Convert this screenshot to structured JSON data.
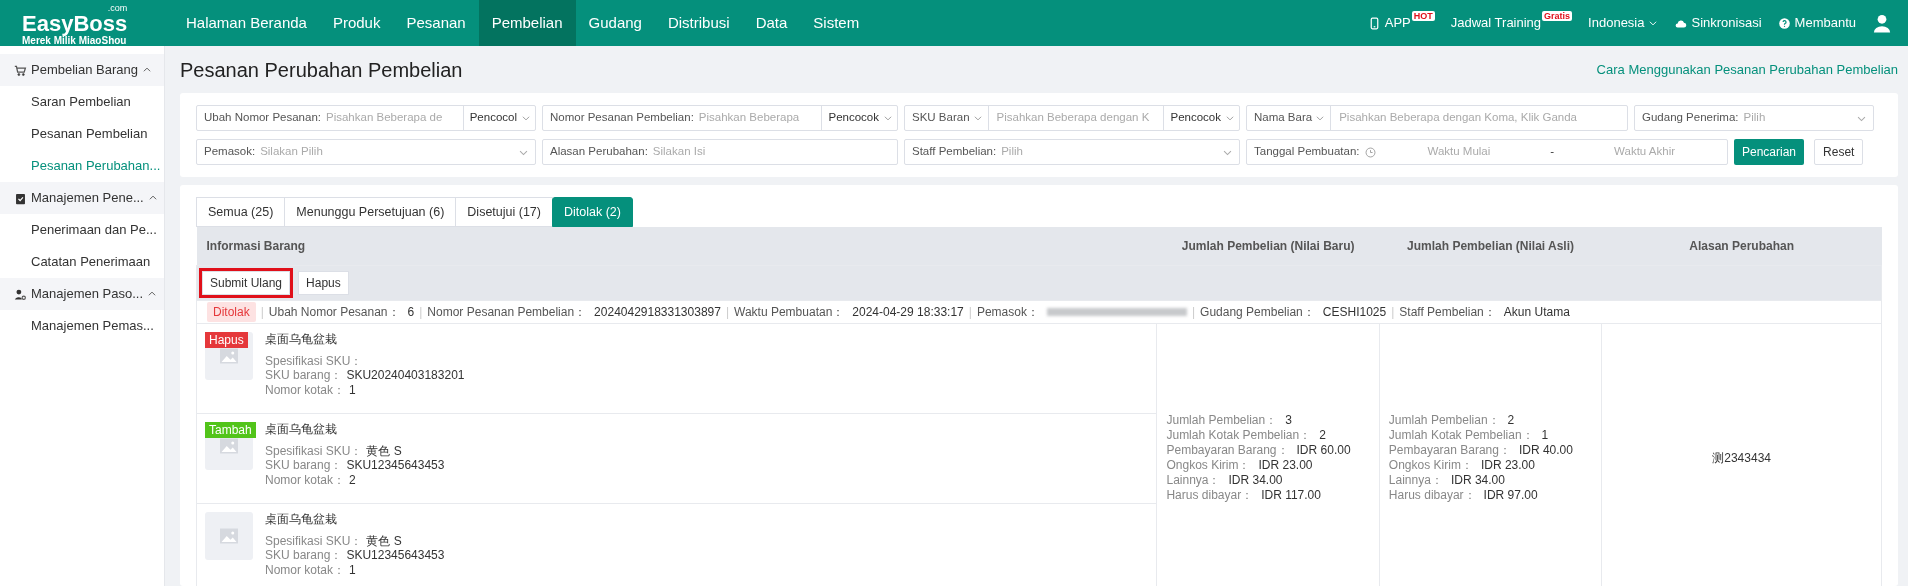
{
  "nav": {
    "logo": "EasyBoss",
    "logo_suffix": ".com",
    "logo_sub": "Merek Milik MiaoShou",
    "menu": [
      {
        "label": "Halaman Beranda",
        "selected": false
      },
      {
        "label": "Produk",
        "selected": false
      },
      {
        "label": "Pesanan",
        "selected": false
      },
      {
        "label": "Pembelian",
        "selected": true
      },
      {
        "label": "Gudang",
        "selected": false
      },
      {
        "label": "Distribusi",
        "selected": false
      },
      {
        "label": "Data",
        "selected": false
      },
      {
        "label": "Sistem",
        "selected": false
      }
    ],
    "right": [
      {
        "kind": "app",
        "label": "APP",
        "sup": "HOT"
      },
      {
        "kind": "training",
        "label": "Jadwal Training",
        "sup": "Gratis"
      },
      {
        "kind": "lang",
        "label": "Indonesia"
      },
      {
        "kind": "sync",
        "label": "Sinkronisasi"
      },
      {
        "kind": "help",
        "label": "Membantu"
      },
      {
        "kind": "user"
      }
    ]
  },
  "sidebar": {
    "groups": [
      {
        "kind": "cart",
        "label": "Pembelian Barang",
        "expanded": true,
        "children": [
          {
            "label": "Saran Pembelian",
            "selected": false
          },
          {
            "label": "Pesanan Pembelian",
            "selected": false
          },
          {
            "label": "Pesanan Perubahan...",
            "selected": true
          }
        ]
      },
      {
        "kind": "clipboard",
        "label": "Manajemen Pene...",
        "expanded": true,
        "children": [
          {
            "label": "Penerimaan dan Pe...",
            "selected": false
          },
          {
            "label": "Catatan Penerimaan",
            "selected": false
          }
        ]
      },
      {
        "kind": "supplier",
        "label": "Manajemen Paso...",
        "expanded": true,
        "children": [
          {
            "label": "Manajemen Pemas...",
            "selected": false
          }
        ]
      }
    ]
  },
  "page": {
    "title": "Pesanan Perubahan Pembelian",
    "help_link": "Cara Menggunakan Pesanan Perubahan Pembelian"
  },
  "filter_rows": [
    [
      {
        "kind": "text_match",
        "label": "Ubah Nomor Pesanan:",
        "placeholder": "Pisahkan Beberapa de",
        "match": "Pencocol"
      },
      {
        "kind": "text_match",
        "label": "Nomor Pesanan Pembelian:",
        "placeholder": "Pisahkan Beberapa",
        "match": "Pencocok"
      },
      {
        "kind": "select_text_match",
        "label": "SKU Baran",
        "placeholder": "Pisahkan Beberapa dengan K",
        "match": "Pencocok"
      },
      {
        "kind": "select_text",
        "label": "Nama Bara",
        "placeholder": "Pisahkan Beberapa dengan Koma, Klik Ganda"
      },
      {
        "kind": "select",
        "label": "Gudang Penerima:",
        "placeholder": "Pilih"
      }
    ],
    [
      {
        "kind": "select",
        "label": "Pemasok:",
        "placeholder": "Silakan Pilih"
      },
      {
        "kind": "text",
        "label": "Alasan Perubahan:",
        "placeholder": "Silakan Isi"
      },
      {
        "kind": "select",
        "label": "Staff Pembelian:",
        "placeholder": "Pilih"
      },
      {
        "kind": "daterange",
        "label": "Tanggal Pembuatan:",
        "start_placeholder": "Waktu Mulai",
        "separator": "-",
        "end_placeholder": "Waktu Akhir"
      }
    ]
  ],
  "filter_buttons": {
    "search": "Pencarian",
    "reset": "Reset"
  },
  "tabs": [
    {
      "label": "Semua (25)",
      "selected": false
    },
    {
      "label": "Menunggu Persetujuan (6)",
      "selected": false
    },
    {
      "label": "Disetujui (17)",
      "selected": false
    },
    {
      "label": "Ditolak (2)",
      "selected": true
    }
  ],
  "table": {
    "columns": [
      "Informasi Barang",
      "Jumlah Pembelian (Nilai Baru)",
      "Jumlah Pembelian (Nilai Asli)",
      "Alasan Perubahan"
    ],
    "actions": [
      {
        "label": "Submit Ulang",
        "highlighted": true
      },
      {
        "label": "Hapus",
        "highlighted": false
      }
    ],
    "order": {
      "status": "Ditolak",
      "separator": "|",
      "fields": [
        {
          "kind": "text",
          "label": "Ubah Nomor Pesanan：",
          "value": "6"
        },
        {
          "kind": "text",
          "label": "Nomor Pesanan Pembelian：",
          "value": "2024042918331303897"
        },
        {
          "kind": "text",
          "label": "Waktu Pembuatan：",
          "value": "2024-04-29 18:33:17"
        },
        {
          "kind": "redacted",
          "label": "Pemasok："
        },
        {
          "kind": "text",
          "label": "Gudang Pembelian：",
          "value": "CESHI1025"
        },
        {
          "kind": "text",
          "label": "Staff Pembelian：",
          "value": "Akun Utama"
        }
      ],
      "items": [
        {
          "tag": {
            "label": "Hapus",
            "color": "#e5383b"
          },
          "name": "桌面乌龟盆栽",
          "details": [
            {
              "label": "Spesifikasi SKU："
            },
            {
              "label": "SKU barang：",
              "value": "SKU20240403183201"
            },
            {
              "label": "Nomor kotak：",
              "value": "1"
            }
          ]
        },
        {
          "tag": {
            "label": "Tambah",
            "color": "#52c41a"
          },
          "name": "桌面乌龟盆栽",
          "details": [
            {
              "label": "Spesifikasi SKU：",
              "value": "黄色 S"
            },
            {
              "label": "SKU barang：",
              "value": "SKU12345643453"
            },
            {
              "label": "Nomor kotak：",
              "value": "2"
            }
          ]
        },
        {
          "name": "桌面乌龟盆栽",
          "details": [
            {
              "label": "Spesifikasi SKU：",
              "value": "黄色 S"
            },
            {
              "label": "SKU barang：",
              "value": "SKU12345643453"
            },
            {
              "label": "Nomor kotak：",
              "value": "1"
            }
          ]
        }
      ],
      "new_values": [
        {
          "label": "Jumlah Pembelian：",
          "value": "3"
        },
        {
          "label": "Jumlah Kotak Pembelian：",
          "value": "2"
        },
        {
          "label": "Pembayaran Barang：",
          "value": "IDR 60.00"
        },
        {
          "label": "Ongkos Kirim：",
          "value": "IDR 23.00"
        },
        {
          "label": "Lainnya：",
          "value": "IDR 34.00"
        },
        {
          "label": "Harus dibayar：",
          "value": "IDR 117.00"
        }
      ],
      "old_values": [
        {
          "label": "Jumlah Pembelian：",
          "value": "2"
        },
        {
          "label": "Jumlah Kotak Pembelian：",
          "value": "1"
        },
        {
          "label": "Pembayaran Barang：",
          "value": "IDR 40.00"
        },
        {
          "label": "Ongkos Kirim：",
          "value": "IDR 23.00"
        },
        {
          "label": "Lainnya：",
          "value": "IDR 34.00"
        },
        {
          "label": "Harus dibayar：",
          "value": "IDR 97.00"
        }
      ],
      "reason": "测2343434"
    }
  }
}
